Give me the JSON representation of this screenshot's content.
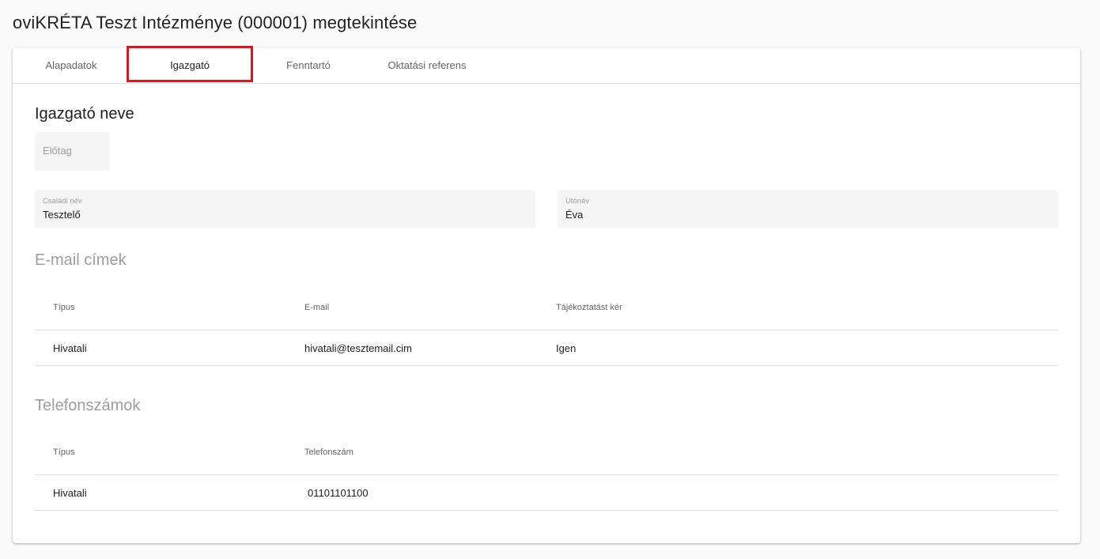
{
  "page": {
    "title": "oviKRÉTA Teszt Intézménye (000001) megtekintése"
  },
  "tabs": [
    {
      "label": "Alapadatok"
    },
    {
      "label": "Igazgató"
    },
    {
      "label": "Fenntartó"
    },
    {
      "label": "Oktatási referens"
    }
  ],
  "active_tab": "Igazgató",
  "colors": {
    "highlight": "#e0161d"
  },
  "director": {
    "heading": "Igazgató neve",
    "prefix": {
      "placeholder": "Előtag",
      "value": ""
    },
    "family_name": {
      "label": "Családi név",
      "value": "Tesztelő"
    },
    "given_name": {
      "label": "Utónév",
      "value": "Éva"
    }
  },
  "emails": {
    "heading": "E-mail címek",
    "columns": [
      "Típus",
      "E-mail",
      "Tájékoztatást kér"
    ],
    "rows": [
      {
        "type": "Hivatali",
        "email": "hivatali@tesztemail.cim",
        "notify": "Igen"
      }
    ]
  },
  "phones": {
    "heading": "Telefonszámok",
    "columns": [
      "Típus",
      "Telefonszám"
    ],
    "rows": [
      {
        "type": "Hivatali",
        "number": "01101101100"
      }
    ]
  }
}
